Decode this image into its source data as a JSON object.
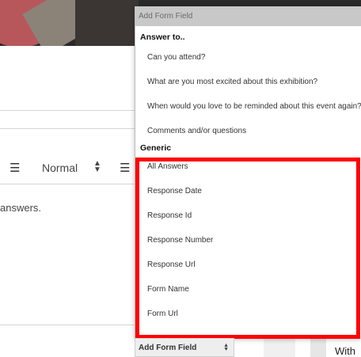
{
  "toolbar": {
    "format_value": "Normal",
    "list_icon": "list-icon",
    "align_icon": "align-icon"
  },
  "editor": {
    "text_fragment": "answers."
  },
  "background": {
    "right_text": "With C"
  },
  "dropdown": {
    "header": "Add Form Field",
    "groups": [
      {
        "label": "Answer to..",
        "options": [
          "Can you attend?",
          "What are you most excited about this exhibition?",
          "When would you love to be reminded about this event again?",
          "Comments and/or questions"
        ]
      },
      {
        "label": "Generic",
        "options": [
          "All Answers",
          "Response Date",
          "Response Id",
          "Response Number",
          "Response Url",
          "Form Name",
          "Form Url"
        ]
      }
    ]
  },
  "select_trigger": {
    "label": "Add Form Field"
  },
  "colors": {
    "highlight": "#ff0000",
    "header_bg": "#c8c8c8"
  }
}
